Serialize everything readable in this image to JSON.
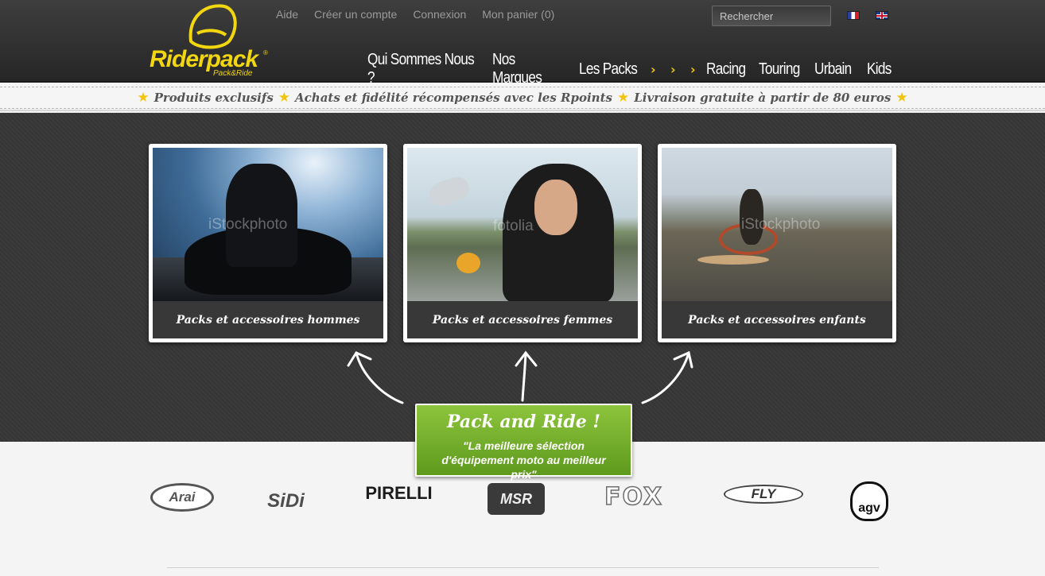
{
  "header": {
    "logo_text": "Riderpack",
    "logo_tagline": "Pack&Ride",
    "logo_reg": "®",
    "top_links": [
      "Aide",
      "Créer un compte",
      "Connexion",
      "Mon panier (0)"
    ],
    "search_placeholder": "Rechercher",
    "flags": [
      "flag-fr-icon",
      "flag-en-icon"
    ],
    "nav": [
      "Qui Sommes Nous ?",
      "Nos Marques",
      "Les Packs",
      "Racing",
      "Touring",
      "Urbain",
      "Kids"
    ],
    "nav_chevron": "›",
    "accent_color": "#f2d60f"
  },
  "strip": {
    "star": "★",
    "items": [
      "Produits exclusifs",
      "Achats et fidélité récompensés avec les Rpoints",
      "Livraison gratuite à partir de 80 euros"
    ]
  },
  "cards": [
    {
      "caption": "Packs et accessoires hommes",
      "watermark": "iStockphoto"
    },
    {
      "caption": "Packs et accessoires femmes",
      "watermark": "fotolia"
    },
    {
      "caption": "Packs et accessoires enfants",
      "watermark": "iStockphoto"
    }
  ],
  "cta": {
    "title": "Pack and Ride !",
    "subtitle": "\"La meilleure sélection d'équipement moto au meilleur prix\""
  },
  "brands": {
    "arai": "Arai",
    "sidi": "SiDi",
    "pirelli": "PIRELLI",
    "msr": "MSR",
    "fox": "FOX",
    "fly": "FLY",
    "agv": "agv"
  }
}
